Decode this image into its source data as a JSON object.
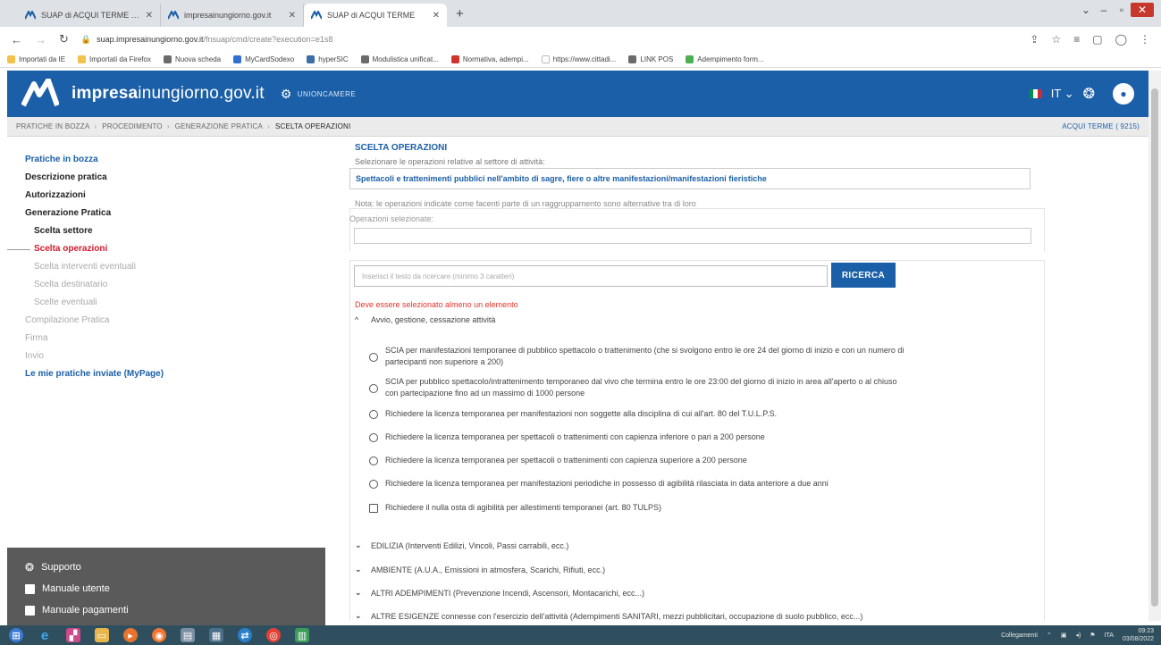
{
  "browser": {
    "tabs": [
      {
        "title": "SUAP di ACQUI TERME - impres",
        "active": false
      },
      {
        "title": "impresainungiorno.gov.it",
        "active": false
      },
      {
        "title": "SUAP di ACQUI TERME",
        "active": true
      }
    ],
    "new_tab": "+",
    "url_host": "suap.impresainungiorno.gov.it",
    "url_path": "/fnsuap/cmd/create?execution=e1s8",
    "bookmarks": [
      {
        "label": "Importati da IE",
        "color": "#f2c24b"
      },
      {
        "label": "Importati da Firefox",
        "color": "#f2c24b"
      },
      {
        "label": "Nuova scheda",
        "color": "#6b6b6b"
      },
      {
        "label": "MyCardSodexo",
        "color": "#2f6fd1"
      },
      {
        "label": "hyperSIC",
        "color": "#3a6ea5"
      },
      {
        "label": "Modulistica unificat...",
        "color": "#6b6b6b"
      },
      {
        "label": "Normativa, adempi...",
        "color": "#d2342c"
      },
      {
        "label": "https://www.cittadi...",
        "color": "#ffffff"
      },
      {
        "label": "LINK POS",
        "color": "#6b6b6b"
      },
      {
        "label": "Adempimento form...",
        "color": "#4caf50"
      }
    ]
  },
  "header": {
    "site_name_bold": "impresa",
    "site_name_rest": "inungiorno.gov.it",
    "partner": "UNIONCAMERE",
    "language": "IT",
    "colors": {
      "brand": "#1b5fa8"
    }
  },
  "breadcrumb": {
    "items": [
      "PRATICHE IN BOZZA",
      "PROCEDIMENTO",
      "GENERAZIONE PRATICA",
      "SCELTA OPERAZIONI"
    ],
    "separator": "›",
    "region": "ACQUI TERME ( 9215)"
  },
  "sidebar": {
    "items": [
      {
        "label": "Pratiche in bozza",
        "style": "link"
      },
      {
        "label": "Descrizione pratica",
        "style": "bold"
      },
      {
        "label": "Autorizzazioni",
        "style": "bold"
      },
      {
        "label": "Generazione Pratica",
        "style": "bold"
      },
      {
        "label": "Scelta settore",
        "style": "sub"
      },
      {
        "label": "Scelta operazioni",
        "style": "active"
      },
      {
        "label": "Scelta interventi eventuali",
        "style": "muted-sub"
      },
      {
        "label": "Scelta destinatario",
        "style": "muted-sub"
      },
      {
        "label": "Scelte eventuali",
        "style": "muted-sub"
      },
      {
        "label": "Compilazione Pratica",
        "style": "muted"
      },
      {
        "label": "Firma",
        "style": "muted"
      },
      {
        "label": "Invio",
        "style": "muted"
      },
      {
        "label": "Le mie pratiche inviate (MyPage)",
        "style": "link"
      }
    ],
    "support": [
      {
        "label": "Supporto",
        "icon": "support-icon"
      },
      {
        "label": "Manuale utente",
        "icon": "document-icon"
      },
      {
        "label": "Manuale pagamenti",
        "icon": "document-icon"
      }
    ]
  },
  "main": {
    "title": "SCELTA OPERAZIONI",
    "subtitle": "Selezionare le operazioni relative al settore di attività:",
    "sector": "Spettacoli e trattenimenti pubblici nell'ambito di sagre, fiere o altre manifestazioni/manifestazioni fieristiche",
    "note": "Nota: le operazioni indicate come facenti parte di un raggruppamento sono alternative tra di loro",
    "selected_label": "Operazioni selezionate:",
    "search_placeholder": "Inserisci il testo da ricercare (minimo 3 caratteri)",
    "search_button": "RICERCA",
    "error": "Deve essere selezionato almeno un elemento",
    "open_group": {
      "label": "Avvio, gestione, cessazione attività",
      "options": [
        {
          "type": "radio",
          "lines": [
            "SCIA per manifestazioni temporanee di pubblico spettacolo o trattenimento (che si svolgono entro le ore 24 del giorno di inizio e con un numero di",
            "partecipanti non superiore a 200)"
          ]
        },
        {
          "type": "radio",
          "lines": [
            "SCIA per pubblico spettacolo/intrattenimento temporaneo dal vivo che termina entro le ore 23:00 del giorno di inizio in area all'aperto o al chiuso",
            "con partecipazione fino ad un massimo di 1000 persone"
          ]
        },
        {
          "type": "radio",
          "lines": [
            "Richiedere la licenza temporanea per manifestazioni non soggette alla disciplina di cui all'art. 80 del T.U.L.P.S."
          ]
        },
        {
          "type": "radio",
          "lines": [
            "Richiedere la licenza temporanea per spettacoli o trattenimenti con capienza inferiore o pari a 200 persone"
          ]
        },
        {
          "type": "radio",
          "lines": [
            "Richiedere la licenza temporanea per spettacoli o trattenimenti con capienza superiore a 200 persone"
          ]
        },
        {
          "type": "radio",
          "lines": [
            "Richiedere la licenza temporanea per manifestazioni periodiche in possesso di agibilità rilasciata in data anteriore a due anni"
          ]
        },
        {
          "type": "checkbox",
          "lines": [
            "Richiedere il nulla osta di agibilità per allestimenti temporanei (art. 80 TULPS)"
          ]
        }
      ]
    },
    "collapsed_groups": [
      "EDILIZIA (Interventi Edilizi, Vincoli, Passi carrabili, ecc.)",
      "AMBIENTE (A.U.A., Emissioni in atmosfera, Scarichi, Rifiuti, ecc.)",
      "ALTRI ADEMPIMENTI (Prevenzione Incendi, Ascensori, Montacarichi, ecc...)",
      "ALTRE ESIGENZE connesse con l'esercizio dell'attività (Adempimenti SANITARI, mezzi pubblicitari, occupazione di suolo pubblico, ecc...)"
    ]
  },
  "taskbar": {
    "network": "Collegamenti",
    "lang": "ITA",
    "time": "09:23",
    "date": "03/08/2022"
  }
}
